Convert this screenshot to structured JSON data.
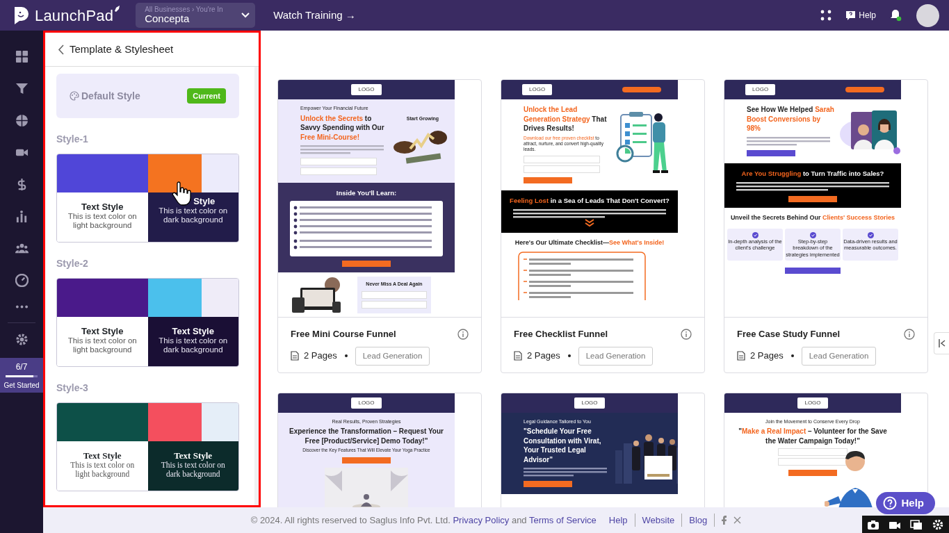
{
  "navbar": {
    "brand": "LaunchPad",
    "business_switcher": {
      "caption": "All Businesses › You're In",
      "value": "Concepta"
    },
    "watch_training": "Watch Training →",
    "help": "Help"
  },
  "rail": {
    "progress": {
      "count": "6/7",
      "level": 0.86,
      "label": "Get Started"
    }
  },
  "panel": {
    "title": "Template & Stylesheet",
    "default_style": {
      "label": "Default Style",
      "badge": "Current"
    },
    "styles": [
      {
        "name": "Style-1",
        "kind": "sans",
        "swatches": [
          {
            "color": "#5046d8"
          },
          {
            "color": "#f47320"
          },
          {
            "color": "#ecebfb"
          }
        ],
        "dark": {
          "color": "#221c4a"
        },
        "light_title": "Text Style",
        "light_text": "This is text color on light background",
        "dark_title": "Style",
        "dark_text": "This is text color on dark background",
        "pointer": true
      },
      {
        "name": "Style-2",
        "kind": "sans",
        "swatches": [
          {
            "color": "#4a1a8a"
          },
          {
            "color": "#4bc0ec"
          },
          {
            "color": "#efecf8"
          }
        ],
        "dark": {
          "color": "#1a0f35"
        },
        "light_title": "Text Style",
        "light_text": "This is text color on light background",
        "dark_title": "Text Style",
        "dark_text": "This is text color on dark background",
        "pointer": false
      },
      {
        "name": "Style-3",
        "kind": "serif",
        "swatches": [
          {
            "color": "#0d5048"
          },
          {
            "color": "#f44f5e"
          },
          {
            "color": "#e5eef8"
          }
        ],
        "dark": {
          "color": "#0c2b2b"
        },
        "light_title": "Text Style",
        "light_text": "This is text color on light background",
        "dark_title": "Text Style",
        "dark_text": "This is text color on dark background",
        "pointer": false
      }
    ]
  },
  "templates": [
    {
      "title": "Free Mini Course Funnel",
      "pages": "2 Pages",
      "tag": "Lead Generation",
      "preview": [
        {
          "kind": "topbar",
          "logo": "LOGO",
          "cta": false
        },
        {
          "kind": "hero",
          "color": "#ece9fb",
          "centered": false,
          "eyebrow": "Empower Your Financial Future",
          "headline": [
            {
              "text": "Unlock the Secrets",
              "accent": true
            },
            {
              "text": " to Savvy Spending with Our ",
              "accent": false
            },
            {
              "text": "Free Mini-Course!",
              "accent": true
            }
          ],
          "aside": "Start Growing",
          "art": {
            "kind": "money"
          },
          "form": true
        },
        {
          "kind": "band",
          "color": "#3a3160",
          "heading": [
            {
              "text": "Inside You'll Learn:",
              "accent": false
            }
          ],
          "checklist": true,
          "chevron": false,
          "button": {
            "color": "#f36b21"
          }
        },
        {
          "kind": "promo",
          "heading": "Never Miss A Deal Again"
        }
      ]
    },
    {
      "title": "Free Checklist Funnel",
      "pages": "2 Pages",
      "tag": "Lead Generation",
      "preview": [
        {
          "kind": "topbar",
          "logo": "LOGO",
          "cta": true
        },
        {
          "kind": "hero",
          "color": "#ffffff",
          "centered": false,
          "headline": [
            {
              "text": "Unlock the Lead Generation Strategy",
              "accent": true
            },
            {
              "text": " That Drives Results!",
              "accent": false
            }
          ],
          "sub": [
            {
              "text": "Download our free proven checklist",
              "accent": true
            },
            {
              "text": " to attract, nurture, and convert high-quality leads.",
              "accent": false
            }
          ],
          "art": {
            "kind": "checklist"
          },
          "form": true,
          "button": {
            "color": "#f36b21"
          }
        },
        {
          "kind": "band",
          "color": "#000000",
          "heading": [
            {
              "text": "Feeling Lost",
              "accent": true
            },
            {
              "text": " in a Sea of Leads That Don't Convert?",
              "accent": false
            }
          ],
          "checklist": false,
          "chevron": true
        },
        {
          "kind": "heading",
          "heading": [
            {
              "text": "Here's Our Ultimate Checklist—",
              "accent": false
            },
            {
              "text": "See What's Inside!",
              "accent": true
            }
          ]
        },
        {
          "kind": "outline-list"
        }
      ]
    },
    {
      "title": "Free Case Study Funnel",
      "pages": "2 Pages",
      "tag": "Lead Generation",
      "preview": [
        {
          "kind": "topbar",
          "logo": "LOGO",
          "cta": true
        },
        {
          "kind": "hero",
          "color": "#ffffff",
          "centered": false,
          "headline": [
            {
              "text": "See How We Helped ",
              "accent": false
            },
            {
              "text": "Sarah Boost Conversions by 98%",
              "accent": true
            }
          ],
          "art": {
            "kind": "portraits"
          },
          "form": false,
          "button": {
            "color": "#5a4bd0"
          }
        },
        {
          "kind": "band",
          "color": "#000000",
          "heading": [
            {
              "text": "Are You Struggling",
              "accent": true
            },
            {
              "text": " to Turn Traffic into Sales?",
              "accent": false
            }
          ],
          "checklist": false,
          "chevron": false,
          "button": {
            "color": "#f36b21"
          }
        },
        {
          "kind": "heading",
          "heading": [
            {
              "text": "Unveil the Secrets Behind Our ",
              "accent": false
            },
            {
              "text": "Clients' Success Stories",
              "accent": true
            }
          ]
        },
        {
          "kind": "features",
          "items": [
            "In-depth analysis of the client's challenge",
            "Step-by-step breakdown of the strategies implemented",
            "Data-driven results and measurable outcomes."
          ]
        }
      ]
    },
    {
      "preview": [
        {
          "kind": "topbar",
          "logo": "LOGO",
          "cta": false
        },
        {
          "kind": "hero",
          "color": "#ece9fb",
          "centered": true,
          "eyebrow": "Real Results, Proven Strategies",
          "headline": [
            {
              "text": "Experience the Transformation – Request Your Free [Product/Service] Demo Today!\"",
              "accent": false
            }
          ],
          "sub": [
            {
              "text": "Discover the Key Features That Will Elevate Your Yoga Practice",
              "accent": false
            }
          ],
          "button": {
            "color": "#f36b21"
          },
          "art": {
            "kind": "yoga"
          },
          "form": false
        }
      ]
    },
    {
      "preview": [
        {
          "kind": "topbar",
          "logo": "LOGO",
          "cta": false
        },
        {
          "kind": "hero",
          "color": "#222c55",
          "centered": false,
          "eyebrow": "Legal Guidance Tailored to You",
          "headline": [
            {
              "text": "\"Schedule Your Free Consultation with Virat, Your Trusted Legal Advisor\"",
              "accent": false
            }
          ],
          "art": {
            "kind": "team"
          },
          "form": false,
          "button": {
            "color": "#f36b21"
          }
        }
      ]
    },
    {
      "preview": [
        {
          "kind": "topbar",
          "logo": "LOGO",
          "cta": false
        },
        {
          "kind": "hero",
          "color": "#ffffff",
          "centered": true,
          "eyebrow": "Join the Movement to Conserve Every Drop",
          "headline": [
            {
              "text": "\"",
              "accent": false
            },
            {
              "text": "Make a Real Impact",
              "accent": true
            },
            {
              "text": " – Volunteer for the Save the Water Campaign Today!\"",
              "accent": false
            }
          ],
          "form": true,
          "button": {
            "color": "#f36b21"
          }
        }
      ]
    }
  ],
  "footer": {
    "copyright": "©  2024. All rights reserved to Saglus Info Pvt. Ltd. ",
    "privacy": "Privacy Policy",
    "joiner": " and ",
    "terms": "Terms of Service",
    "links": [
      "Help",
      "Website",
      "Blog"
    ]
  },
  "help_button": "Help"
}
